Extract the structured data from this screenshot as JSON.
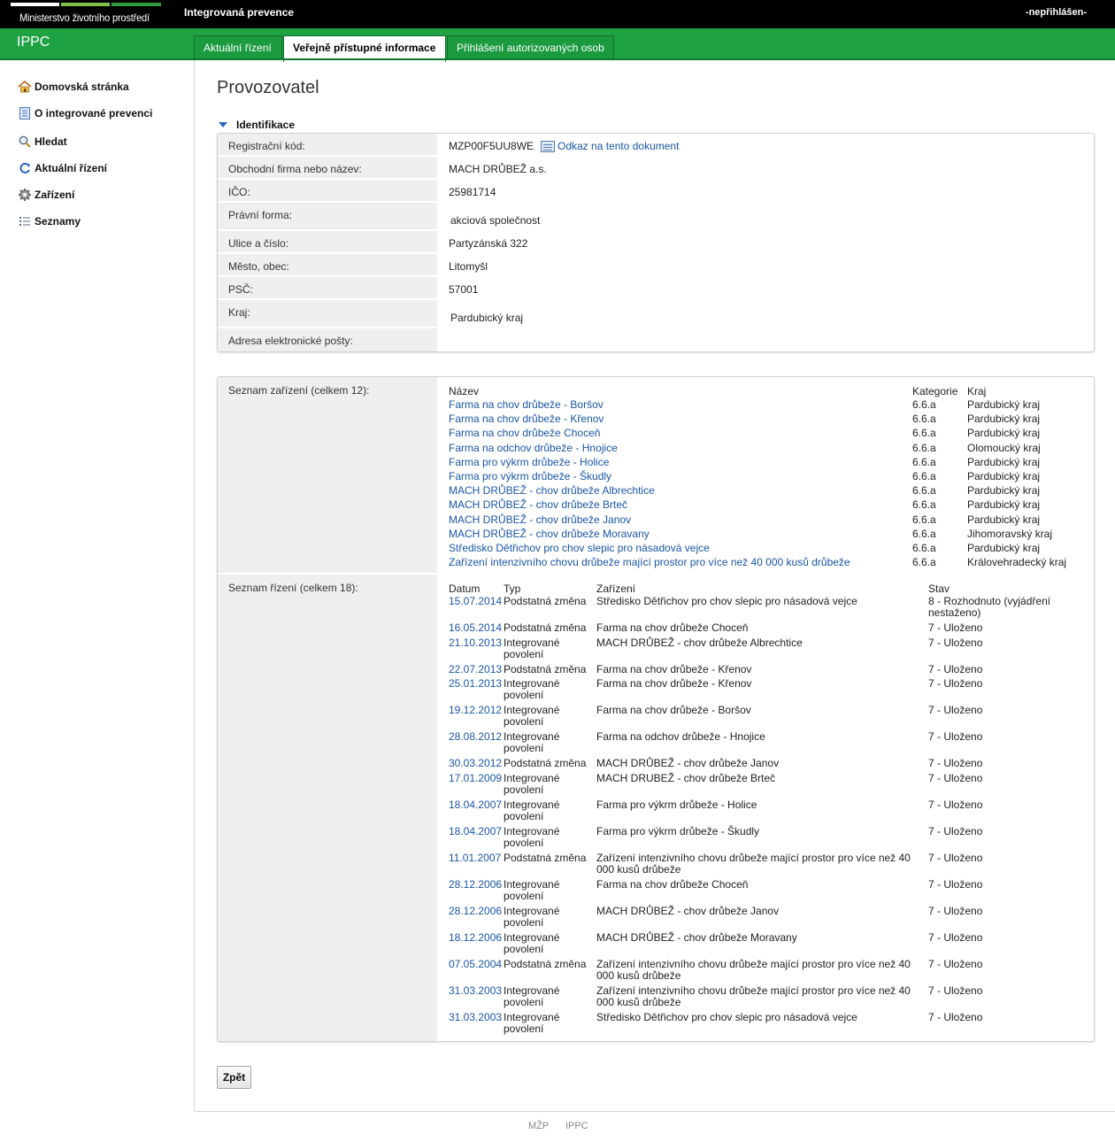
{
  "header": {
    "ministry": "Ministerstvo životního prostředí",
    "app_title": "Integrovaná prevence",
    "user_status": "-nepřihlášen-",
    "brand": "IPPC"
  },
  "tabs": [
    "Aktuální řízení",
    "Veřejně přístupné informace",
    "Přihlášení autorizovaných osob"
  ],
  "sidebar": {
    "items": [
      "Domovská stránka",
      "O integrované prevenci",
      "Hledat",
      "Aktuální řízení",
      "Zařízení",
      "Seznamy"
    ]
  },
  "page": {
    "title": "Provozovatel",
    "section": "Identifikace",
    "doc_link": "Odkaz na tento dokument",
    "back": "Zpět"
  },
  "identification": [
    {
      "label": "Registrační kód:",
      "value": "MZP00F5UU8WE"
    },
    {
      "label": "Obchodní firma nebo název:",
      "value": "MACH DRŮBEŽ a.s."
    },
    {
      "label": "IČO:",
      "value": "25981714"
    },
    {
      "label": "Právní forma:",
      "value": "akciová společnost"
    },
    {
      "label": "Ulice a číslo:",
      "value": "Partyzánská 322"
    },
    {
      "label": "Město, obec:",
      "value": "Litomyšl"
    },
    {
      "label": "PSČ:",
      "value": "57001"
    },
    {
      "label": "Kraj:",
      "value": "Pardubický kraj"
    },
    {
      "label": "Adresa elektronické pošty:",
      "value": ""
    }
  ],
  "facilities": {
    "label": "Seznam zařízení (celkem 12):",
    "headers": [
      "Název",
      "Kategorie",
      "Kraj"
    ],
    "rows": [
      [
        "Farma na chov drůbeže - Boršov",
        "6.6.a",
        "Pardubický kraj"
      ],
      [
        "Farma na chov drůbeže - Křenov",
        "6.6.a",
        "Pardubický kraj"
      ],
      [
        "Farma na chov drůbeže Choceň",
        "6.6.a",
        "Pardubický kraj"
      ],
      [
        "Farma na odchov drůbeže - Hnojice",
        "6.6.a",
        "Olomoucký kraj"
      ],
      [
        "Farma pro výkrm drůbeže - Holice",
        "6.6.a",
        "Pardubický kraj"
      ],
      [
        "Farma pro výkrm drůbeže - Škudly",
        "6.6.a",
        "Pardubický kraj"
      ],
      [
        "MACH DRŮBEŽ - chov drůbeže Albrechtice",
        "6.6.a",
        "Pardubický kraj"
      ],
      [
        "MACH DRŮBEŽ - chov drůbeže Brteč",
        "6.6.a",
        "Pardubický kraj"
      ],
      [
        "MACH DRŮBEŽ - chov drůbeže Janov",
        "6.6.a",
        "Pardubický kraj"
      ],
      [
        "MACH DRŮBEŽ - chov drůbeže Moravany",
        "6.6.a",
        "Jihomoravský kraj"
      ],
      [
        "Středisko Dětřichov pro chov slepic pro násadová vejce",
        "6.6.a",
        "Pardubický kraj"
      ],
      [
        "Zařízení intenzivního chovu drůbeže mající prostor pro více než 40 000 kusů drůbeže",
        "6.6.a",
        "Královehradecký kraj"
      ]
    ]
  },
  "proceedings": {
    "label": "Seznam řízení (celkem 18):",
    "headers": [
      "Datum",
      "Typ",
      "Zařízení",
      "Stav"
    ],
    "rows": [
      {
        "date": "15.07.2014",
        "type": [
          "Podstatná změna"
        ],
        "facility": [
          "Středisko Dětřichov pro chov slepic pro násadová vejce"
        ],
        "state": [
          "8 - Rozhodnuto (vyjádření",
          "nestaženo)"
        ]
      },
      {
        "date": "16.05.2014",
        "type": [
          "Podstatná změna"
        ],
        "facility": [
          "Farma na chov drůbeže Choceň"
        ],
        "state": [
          "7 - Uloženo"
        ]
      },
      {
        "date": "21.10.2013",
        "type": [
          "Integrované",
          "povolení"
        ],
        "facility": [
          "MACH DRŮBEŽ - chov drůbeže Albrechtice"
        ],
        "state": [
          "7 - Uloženo"
        ]
      },
      {
        "date": "22.07.2013",
        "type": [
          "Podstatná změna"
        ],
        "facility": [
          "Farma na chov drůbeže - Křenov"
        ],
        "state": [
          "7 - Uloženo"
        ]
      },
      {
        "date": "25.01.2013",
        "type": [
          "Integrované",
          "povolení"
        ],
        "facility": [
          "Farma na chov drůbeže - Křenov"
        ],
        "state": [
          "7 - Uloženo"
        ]
      },
      {
        "date": "19.12.2012",
        "type": [
          "Integrované",
          "povolení"
        ],
        "facility": [
          "Farma na chov drůbeže - Boršov"
        ],
        "state": [
          "7 - Uloženo"
        ]
      },
      {
        "date": "28.08.2012",
        "type": [
          "Integrované",
          "povolení"
        ],
        "facility": [
          "Farma na odchov drůbeže - Hnojice"
        ],
        "state": [
          "7 - Uloženo"
        ]
      },
      {
        "date": "30.03.2012",
        "type": [
          "Podstatná změna"
        ],
        "facility": [
          "MACH DRŮBEŽ - chov drůbeže Janov"
        ],
        "state": [
          "7 - Uloženo"
        ]
      },
      {
        "date": "17.01.2009",
        "type": [
          "Integrované",
          "povolení"
        ],
        "facility": [
          "MACH DRUBEŽ - chov drůbeže Brteč"
        ],
        "state": [
          "7 - Uloženo"
        ]
      },
      {
        "date": "18.04.2007",
        "type": [
          "Integrované",
          "povolení"
        ],
        "facility": [
          "Farma pro výkrm drůbeže - Holice"
        ],
        "state": [
          "7 - Uloženo"
        ]
      },
      {
        "date": "18.04.2007",
        "type": [
          "Integrované",
          "povolení"
        ],
        "facility": [
          "Farma pro výkrm drůbeže - Škudly"
        ],
        "state": [
          "7 - Uloženo"
        ]
      },
      {
        "date": "11.01.2007",
        "type": [
          "Podstatná změna"
        ],
        "facility": [
          "Zařízení intenzivního chovu drůbeže mající prostor pro více než 40",
          "000 kusů drůbeže"
        ],
        "state": [
          "7 - Uloženo"
        ]
      },
      {
        "date": "28.12.2006",
        "type": [
          "Integrované",
          "povolení"
        ],
        "facility": [
          "Farma na chov drůbeže Choceň"
        ],
        "state": [
          "7 - Uloženo"
        ]
      },
      {
        "date": "28.12.2006",
        "type": [
          "Integrované",
          "povolení"
        ],
        "facility": [
          "MACH DRŮBEŽ - chov drůbeže Janov"
        ],
        "state": [
          "7 - Uloženo"
        ]
      },
      {
        "date": "18.12.2006",
        "type": [
          "Integrované",
          "povolení"
        ],
        "facility": [
          "MACH DRŮBEŽ - chov drůbeže Moravany"
        ],
        "state": [
          "7 - Uloženo"
        ]
      },
      {
        "date": "07.05.2004",
        "type": [
          "Podstatná změna"
        ],
        "facility": [
          "Zařízení intenzivního chovu drůbeže mající prostor pro více než 40",
          "000 kusů drůbeže"
        ],
        "state": [
          "7 - Uloženo"
        ]
      },
      {
        "date": "31.03.2003",
        "type": [
          "Integrované",
          "povolení"
        ],
        "facility": [
          "Zařízení intenzivního chovu drůbeže mající prostor pro více než 40",
          "000 kusů drůbeže"
        ],
        "state": [
          "7 - Uloženo"
        ]
      },
      {
        "date": "31.03.2003",
        "type": [
          "Integrované",
          "povolení"
        ],
        "facility": [
          "Středisko Dětřichov pro chov slepic pro násadová vejce"
        ],
        "state": [
          "7 - Uloženo"
        ]
      }
    ]
  },
  "footer": [
    "MŽP",
    "IPPC"
  ],
  "colors": {
    "green": "#1fa244",
    "link": "#1a56a6",
    "label_bg": "#efefef"
  }
}
